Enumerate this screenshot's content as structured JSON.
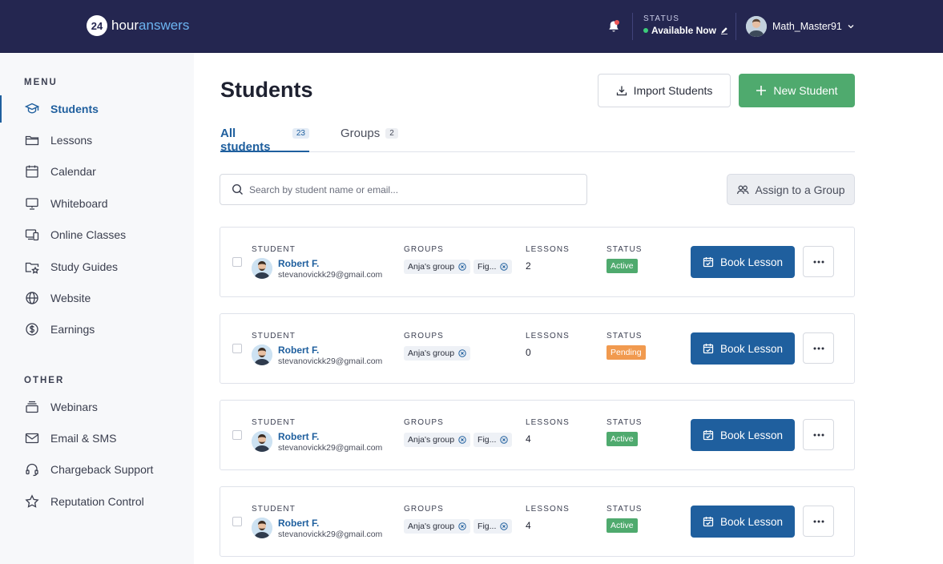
{
  "header": {
    "logo_badge": "24",
    "logo_text_1": "hour",
    "logo_text_2": "answers",
    "status_label": "STATUS",
    "status_value": "Available Now",
    "username": "Math_Master91"
  },
  "sidebar": {
    "menu_label": "MENU",
    "other_label": "OTHER",
    "menu_items": [
      {
        "label": "Students",
        "icon": "graduation-cap-icon"
      },
      {
        "label": "Lessons",
        "icon": "folder-icon"
      },
      {
        "label": "Calendar",
        "icon": "calendar-icon"
      },
      {
        "label": "Whiteboard",
        "icon": "whiteboard-icon"
      },
      {
        "label": "Online Classes",
        "icon": "devices-icon"
      },
      {
        "label": "Study Guides",
        "icon": "folder-star-icon"
      },
      {
        "label": "Website",
        "icon": "globe-icon"
      },
      {
        "label": "Earnings",
        "icon": "dollar-circle-icon"
      }
    ],
    "other_items": [
      {
        "label": "Webinars",
        "icon": "stack-icon"
      },
      {
        "label": "Email & SMS",
        "icon": "mail-icon"
      },
      {
        "label": "Chargeback Support",
        "icon": "headset-icon"
      },
      {
        "label": "Reputation Control",
        "icon": "star-icon"
      }
    ]
  },
  "main": {
    "title": "Students",
    "import_label": "Import Students",
    "new_label": "New Student",
    "tabs": [
      {
        "label": "All students",
        "count": "23"
      },
      {
        "label": "Groups",
        "count": "2"
      }
    ],
    "search_placeholder": "Search by student name or email...",
    "assign_label": "Assign to a Group",
    "col_labels": {
      "student": "STUDENT",
      "groups": "GROUPS",
      "lessons": "LESSONS",
      "status": "STATUS"
    },
    "book_label": "Book Lesson"
  },
  "status_colors": {
    "Active": "#4faa6e",
    "Pending": "#f19a4f"
  },
  "students": [
    {
      "name": "Robert F.",
      "email": "stevanovickk29@gmail.com",
      "groups": [
        "Anja's group",
        "Fig..."
      ],
      "lessons": "2",
      "status": "Active"
    },
    {
      "name": "Robert F.",
      "email": "stevanovickk29@gmail.com",
      "groups": [
        "Anja's group"
      ],
      "lessons": "0",
      "status": "Pending"
    },
    {
      "name": "Robert F.",
      "email": "stevanovickk29@gmail.com",
      "groups": [
        "Anja's group",
        "Fig..."
      ],
      "lessons": "4",
      "status": "Active"
    },
    {
      "name": "Robert F.",
      "email": "stevanovickk29@gmail.com",
      "groups": [
        "Anja's group",
        "Fig..."
      ],
      "lessons": "4",
      "status": "Active"
    }
  ]
}
